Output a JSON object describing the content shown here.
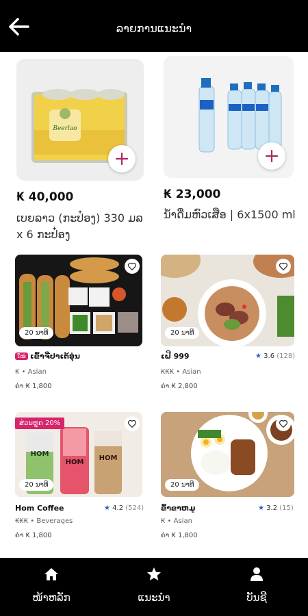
{
  "header": {
    "title": "ລາຍການແນະນຳ"
  },
  "products": [
    {
      "price": "₭ 40,000",
      "name": "ເບຍລາວ (ກະປ໋ອງ) 330 ມລ x 6 ກະປ໋ອງ",
      "can_brand": "Beerlao"
    },
    {
      "price": "₭ 23,000",
      "name": "ນ້ຳດື່ມຫົວເສືອ | 6x1500 ml"
    }
  ],
  "restaurants": [
    {
      "name": "ເຂົ້າຈີ່ປາເຕ້ອຸ່ນ",
      "tag": "ໃໝ່",
      "meta": "₭ • Asian",
      "fee": "ຄ່າ ₭ 1,800",
      "time": "20 ນາທີ"
    },
    {
      "name": "ເຝີ 999",
      "rating": "3.6",
      "count": "(128)",
      "meta": "₭₭₭ • Asian",
      "fee": "ຄ່າ ₭ 2,800",
      "time": "20 ນາທີ"
    },
    {
      "name": "Hom Coffee",
      "rating": "4.2",
      "count": "(524)",
      "meta": "₭₭₭ • Beverages",
      "fee": "ຄ່າ ₭ 1,800",
      "time": "20 ນາທີ",
      "promo": "ສ່ວນຫຼຸດ 20%"
    },
    {
      "name": "ຂົ້າຂາຫມູ",
      "rating": "3.2",
      "count": "(15)",
      "meta": "₭ • Asian",
      "fee": "ຄ່າ ₭ 1,800",
      "time": "20 ນາທີ"
    }
  ],
  "cup_brand": [
    "HOM",
    "HOM",
    "HOM"
  ],
  "footer": {
    "home": "ໜ້າຫລັກ",
    "recommend": "ແນະນຳ",
    "account": "ບັນຊີ"
  },
  "colors": {
    "accent": "#d6256b",
    "star": "#2a5cc9",
    "header": "#000000"
  }
}
